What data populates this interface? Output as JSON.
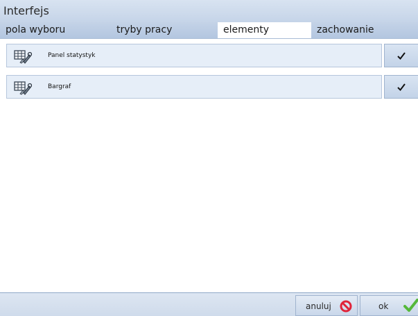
{
  "window": {
    "title": "Interfejs"
  },
  "tabs": [
    {
      "label": "pola wyboru",
      "active": false
    },
    {
      "label": "tryby pracy",
      "active": false
    },
    {
      "label": "elementy",
      "active": true
    },
    {
      "label": "zachowanie",
      "active": false
    }
  ],
  "elements": [
    {
      "label": "Panel statystyk",
      "icon": "tools-icon",
      "checked": true
    },
    {
      "label": "Bargraf",
      "icon": "tools-icon",
      "checked": true
    }
  ],
  "footer": {
    "cancel_label": "anuluj",
    "cancel_icon": "no-entry-icon",
    "ok_label": "ok",
    "ok_icon": "green-check-icon"
  },
  "colors": {
    "accent_red": "#e0243a",
    "accent_green": "#55b83a"
  }
}
